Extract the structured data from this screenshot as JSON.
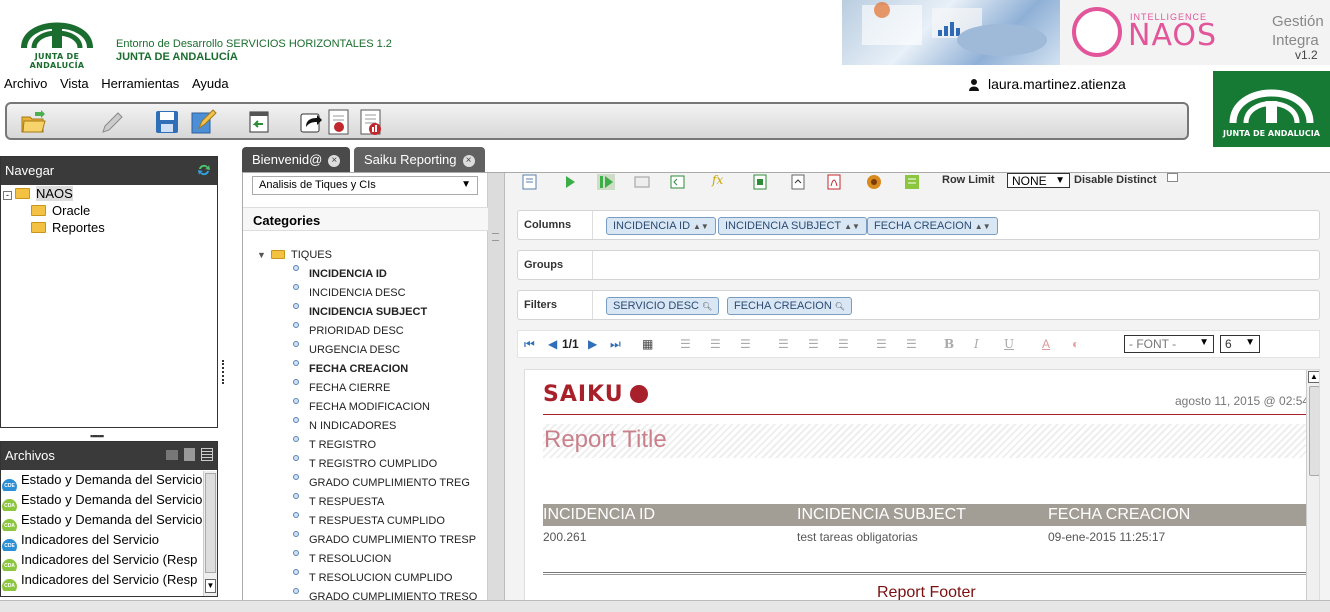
{
  "header": {
    "logo_text": "JUNTA DE ANDALUCÍA",
    "env_title": "Entorno de Desarrollo SERVICIOS HORIZONTALES 1.2",
    "env_org": "JUNTA DE ANDALUCÍA",
    "naos_intel": "INTELLIGENCE",
    "naos_name": "NAOS",
    "naos_gestion": "Gestión",
    "naos_integra": "Integra",
    "naos_version": "v1.2",
    "right_logo_text": "JUNTA DE ANDALUCIA"
  },
  "menu": {
    "items": [
      "Archivo",
      "Vista",
      "Herramientas",
      "Ayuda"
    ]
  },
  "user": {
    "name": "laura.martinez.atienza"
  },
  "toolbar": {
    "buttons": [
      "open-folder-icon",
      "edit-pencil-icon",
      "save-icon",
      "edit-document-icon",
      "back-window-icon",
      "share-arrow-icon",
      "report-icon",
      "report-chart-icon"
    ]
  },
  "navegar": {
    "title": "Navegar",
    "root": "NAOS",
    "children": [
      "Oracle",
      "Reportes"
    ]
  },
  "archivos": {
    "title": "Archivos",
    "items": [
      {
        "label": "Estado y Demanda del Servicio",
        "badge": "CDE",
        "color": "#2a8fd4"
      },
      {
        "label": "Estado y Demanda del Servicio",
        "badge": "CDA",
        "color": "#8cc63f"
      },
      {
        "label": "Estado y Demanda del Servicio",
        "badge": "CDA",
        "color": "#8cc63f"
      },
      {
        "label": "Indicadores del Servicio",
        "badge": "CDE",
        "color": "#2a8fd4"
      },
      {
        "label": "Indicadores del Servicio (Resp",
        "badge": "CDA",
        "color": "#8cc63f"
      },
      {
        "label": "Indicadores del Servicio (Resp",
        "badge": "CDA",
        "color": "#8cc63f"
      }
    ]
  },
  "tabs": [
    {
      "label": "Bienvenid@"
    },
    {
      "label": "Saiku Reporting"
    }
  ],
  "categories": {
    "cube_selected": "Analisis de Tiques y CIs",
    "title": "Categories",
    "dimension": "TIQUES",
    "levels": [
      {
        "label": "INCIDENCIA ID",
        "selected": true
      },
      {
        "label": "INCIDENCIA DESC",
        "selected": false
      },
      {
        "label": "INCIDENCIA SUBJECT",
        "selected": true
      },
      {
        "label": "PRIORIDAD DESC",
        "selected": false
      },
      {
        "label": "URGENCIA DESC",
        "selected": false
      },
      {
        "label": "FECHA CREACION",
        "selected": true
      },
      {
        "label": "FECHA CIERRE",
        "selected": false
      },
      {
        "label": "FECHA MODIFICACION",
        "selected": false
      },
      {
        "label": "N INDICADORES",
        "selected": false
      },
      {
        "label": "T REGISTRO",
        "selected": false
      },
      {
        "label": "T REGISTRO CUMPLIDO",
        "selected": false
      },
      {
        "label": "GRADO CUMPLIMIENTO TREG",
        "selected": false
      },
      {
        "label": "T RESPUESTA",
        "selected": false
      },
      {
        "label": "T RESPUESTA CUMPLIDO",
        "selected": false
      },
      {
        "label": "GRADO CUMPLIMIENTO TRESP",
        "selected": false
      },
      {
        "label": "T RESOLUCION",
        "selected": false
      },
      {
        "label": "T RESOLUCION CUMPLIDO",
        "selected": false
      },
      {
        "label": "GRADO CUMPLIMIENTO TRESO",
        "selected": false
      }
    ]
  },
  "workspace": {
    "row_limit_label": "Row Limit",
    "row_limit_value": "NONE",
    "disable_distinct_label": "Disable Distinct",
    "columns_label": "Columns",
    "groups_label": "Groups",
    "filters_label": "Filters",
    "columns": [
      "INCIDENCIA ID",
      "INCIDENCIA SUBJECT",
      "FECHA CREACION"
    ],
    "filters": [
      "SERVICIO DESC",
      "FECHA CREACION"
    ],
    "page_indicator": "1/1",
    "font_select": "- FONT -",
    "size_select": "6"
  },
  "report": {
    "logo": "SAIKU",
    "date": "agosto 11, 2015 @ 02:54",
    "title": "Report Title",
    "headers": [
      "INCIDENCIA ID",
      "INCIDENCIA SUBJECT",
      "FECHA CREACION"
    ],
    "row": [
      "200.261",
      "test tareas obligatorias",
      "09-ene-2015 11:25:17"
    ],
    "footer": "Report Footer"
  }
}
